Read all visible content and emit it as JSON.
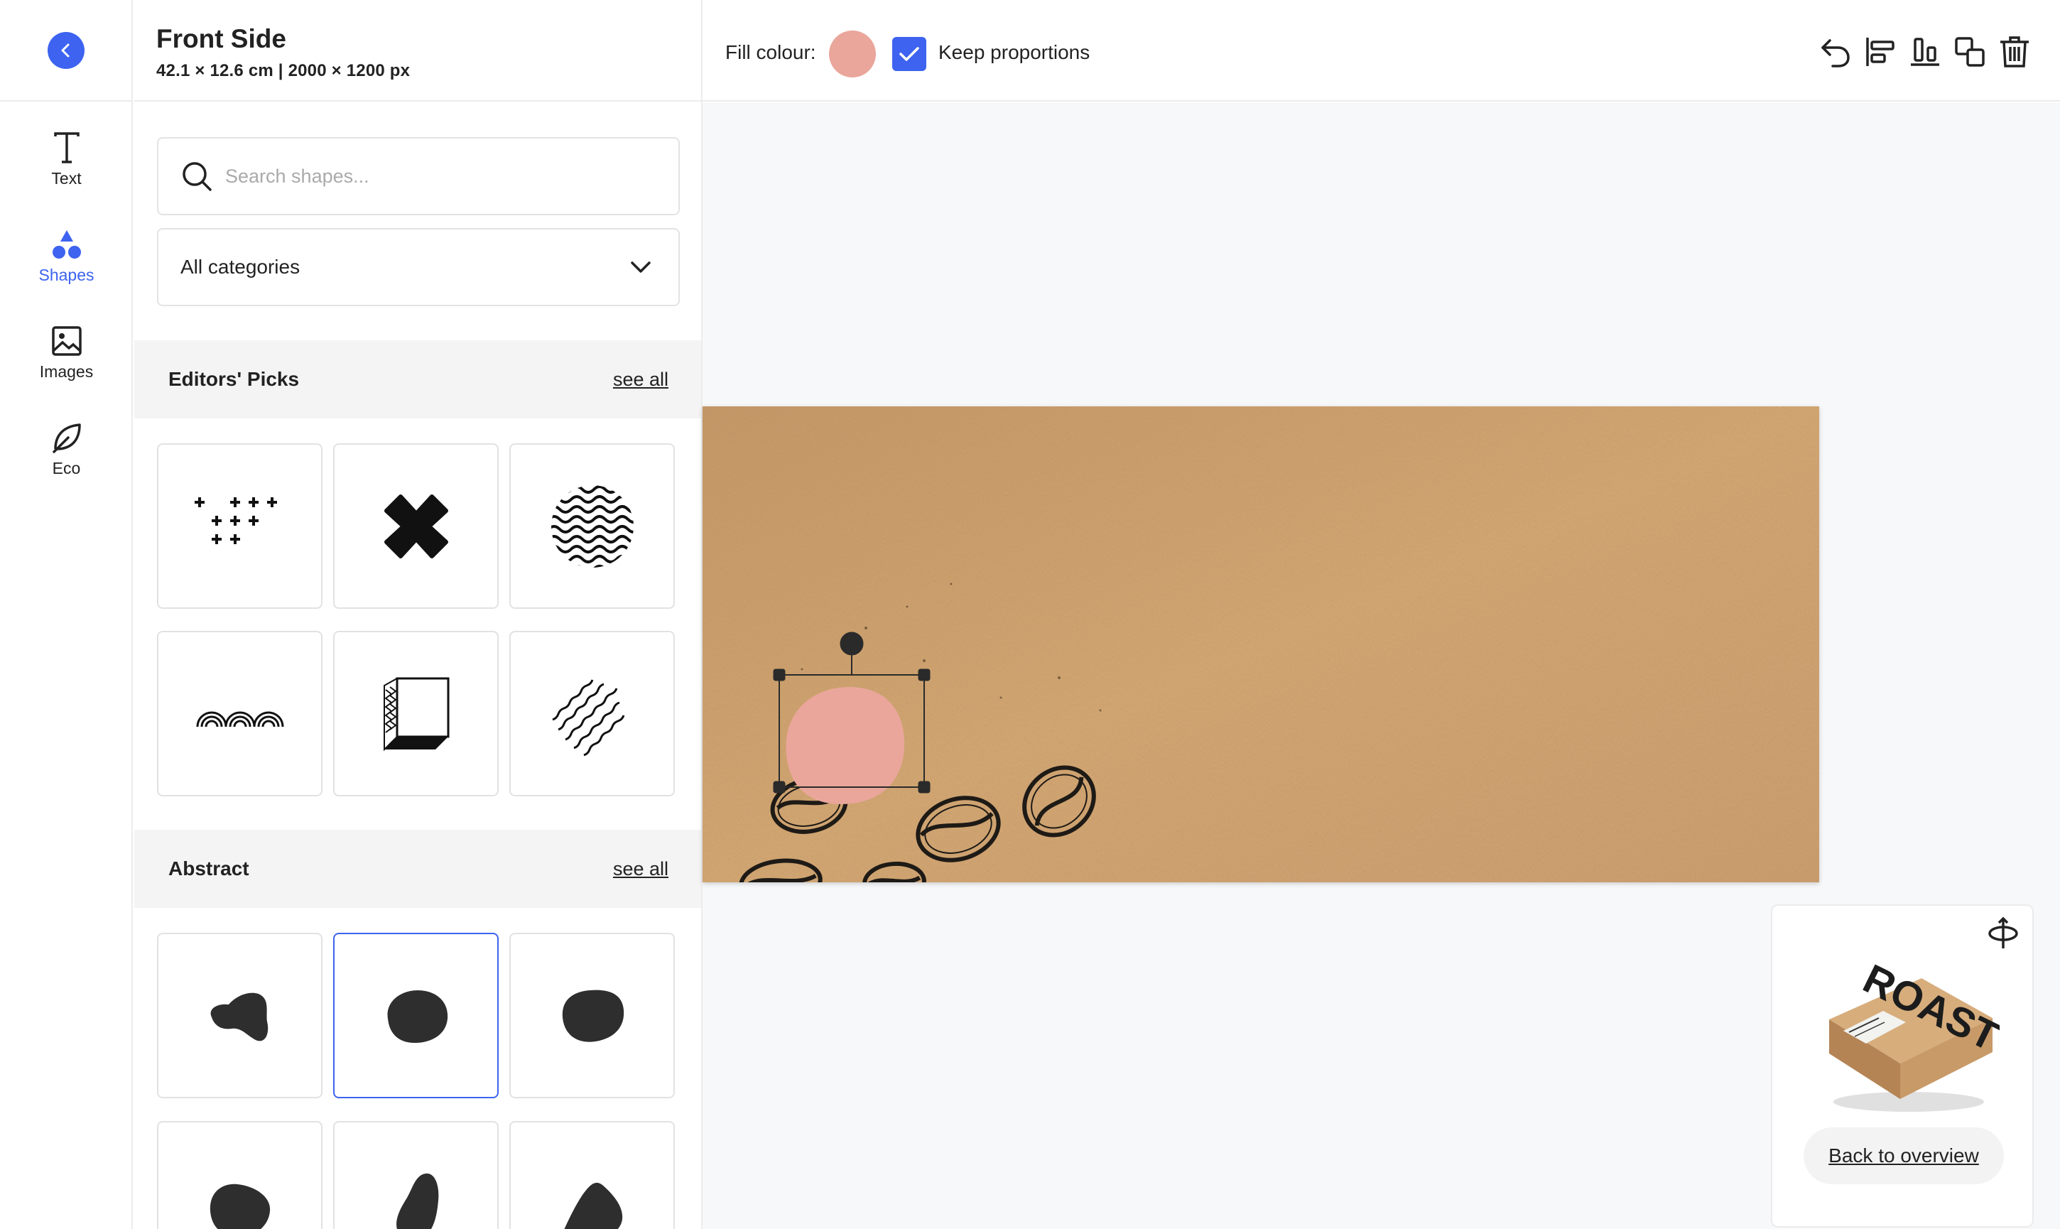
{
  "rail": {
    "items": [
      {
        "label": "Text",
        "icon": "text-icon"
      },
      {
        "label": "Shapes",
        "icon": "shapes-icon",
        "active": true
      },
      {
        "label": "Images",
        "icon": "image-icon"
      },
      {
        "label": "Eco",
        "icon": "leaf-icon"
      }
    ]
  },
  "document": {
    "title": "Front Side",
    "subtitle": "42.1 × 12.6 cm | 2000 × 1200 px"
  },
  "search": {
    "placeholder": "Search shapes..."
  },
  "category": {
    "selected": "All categories"
  },
  "sections": [
    {
      "title": "Editors' Picks",
      "link": "see all"
    },
    {
      "title": "Abstract",
      "link": "see all"
    }
  ],
  "toolbar": {
    "fill_label": "Fill colour:",
    "fill_color": "#eaa69b",
    "keep_proportions_label": "Keep proportions",
    "keep_proportions_checked": true,
    "tools": [
      "undo-icon",
      "align-left-icon",
      "align-bottom-icon",
      "duplicate-icon",
      "delete-icon"
    ]
  },
  "preview": {
    "button_label": "Back to overview",
    "box_text": "ROAST"
  },
  "colors": {
    "accent": "#3d63f0",
    "kraft": "#d4a570",
    "shape_dark": "#2e2e2e"
  }
}
